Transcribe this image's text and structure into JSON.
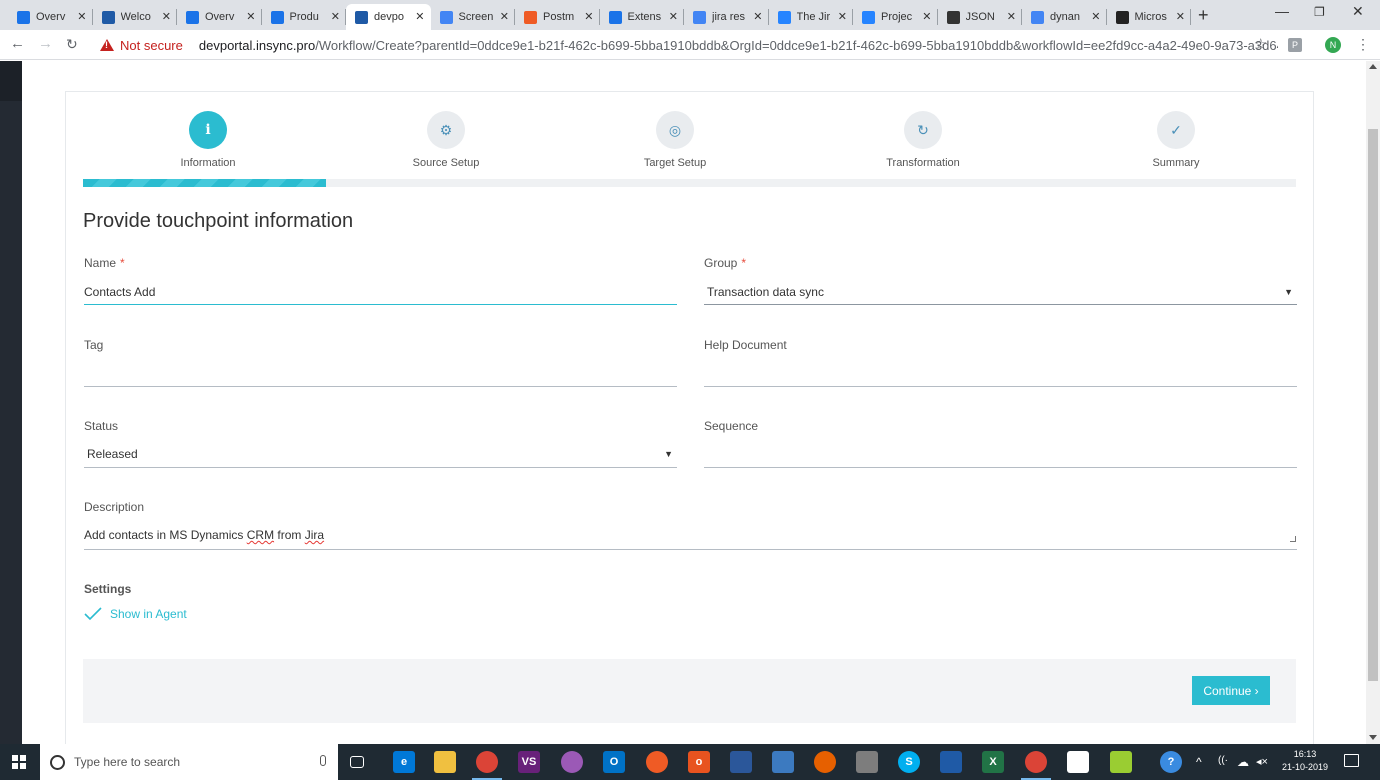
{
  "browser": {
    "tabs": [
      {
        "title": "Overv",
        "favicon": "insync-icon",
        "color": "#1a73e8"
      },
      {
        "title": "Welco",
        "favicon": "cloud-icon",
        "color": "#1f5aa6"
      },
      {
        "title": "Overv",
        "favicon": "insync-icon",
        "color": "#1a73e8"
      },
      {
        "title": "Produ",
        "favicon": "insync-icon",
        "color": "#1a73e8"
      },
      {
        "title": "devpo",
        "favicon": "cloud-icon",
        "color": "#1f5aa6",
        "active": true
      },
      {
        "title": "Screen",
        "favicon": "docs-icon",
        "color": "#4285f4"
      },
      {
        "title": "Postm",
        "favicon": "postman-icon",
        "color": "#ef5b25"
      },
      {
        "title": "Extens",
        "favicon": "puzzle-icon",
        "color": "#1a73e8"
      },
      {
        "title": "jira res",
        "favicon": "google-icon",
        "color": "#4285f4"
      },
      {
        "title": "The Jir",
        "favicon": "jira-icon",
        "color": "#2684ff"
      },
      {
        "title": "Projec",
        "favicon": "jira-software-icon",
        "color": "#2684ff"
      },
      {
        "title": "JSON",
        "favicon": "json-icon",
        "color": "#333333"
      },
      {
        "title": "dynan",
        "favicon": "google-icon",
        "color": "#4285f4"
      },
      {
        "title": "Micros",
        "favicon": "ce-icon",
        "color": "#222222"
      }
    ],
    "address": {
      "security": "Not secure",
      "host": "devportal.insync.pro",
      "path": "/Workflow/Create?parentId=0ddce9e1-b21f-462c-b699-5bba1910bddb&OrgId=0ddce9e1-b21f-462c-b699-5bba1910bddb&workflowId=ee2fd9cc-a4a2-49e0-9a73-a3d642d..."
    },
    "extension_label": "P",
    "profile_initial": "N"
  },
  "wizard": {
    "steps": [
      {
        "label": "Information",
        "icon": "info-icon",
        "glyph": "i",
        "active": true
      },
      {
        "label": "Source Setup",
        "icon": "gears-icon",
        "glyph": "⚙",
        "active": false
      },
      {
        "label": "Target Setup",
        "icon": "target-icon",
        "glyph": "◎",
        "active": false
      },
      {
        "label": "Transformation",
        "icon": "refresh-icon",
        "glyph": "↻",
        "active": false
      },
      {
        "label": "Summary",
        "icon": "check-circle-icon",
        "glyph": "✓",
        "active": false
      }
    ],
    "progress": 0.2,
    "accent": "#2bbcd0"
  },
  "form": {
    "title": "Provide touchpoint information",
    "name": {
      "label": "Name",
      "required_mark": "*",
      "value": "Contacts Add"
    },
    "group": {
      "label": "Group",
      "required_mark": "*",
      "value": "Transaction data sync"
    },
    "tag": {
      "label": "Tag",
      "value": ""
    },
    "help_document": {
      "label": "Help Document",
      "value": ""
    },
    "status": {
      "label": "Status",
      "value": "Released"
    },
    "sequence": {
      "label": "Sequence",
      "value": ""
    },
    "description": {
      "label": "Description",
      "value_parts": [
        "Add contacts in MS Dynamics ",
        "CRM",
        " from ",
        "Jira"
      ]
    },
    "settings": {
      "label": "Settings",
      "show_in_agent": {
        "label": "Show in Agent",
        "checked": true
      }
    },
    "continue_label": "Continue ›"
  },
  "taskbar": {
    "search_placeholder": "Type here to search",
    "time": "16:13",
    "date": "21-10-2019"
  }
}
